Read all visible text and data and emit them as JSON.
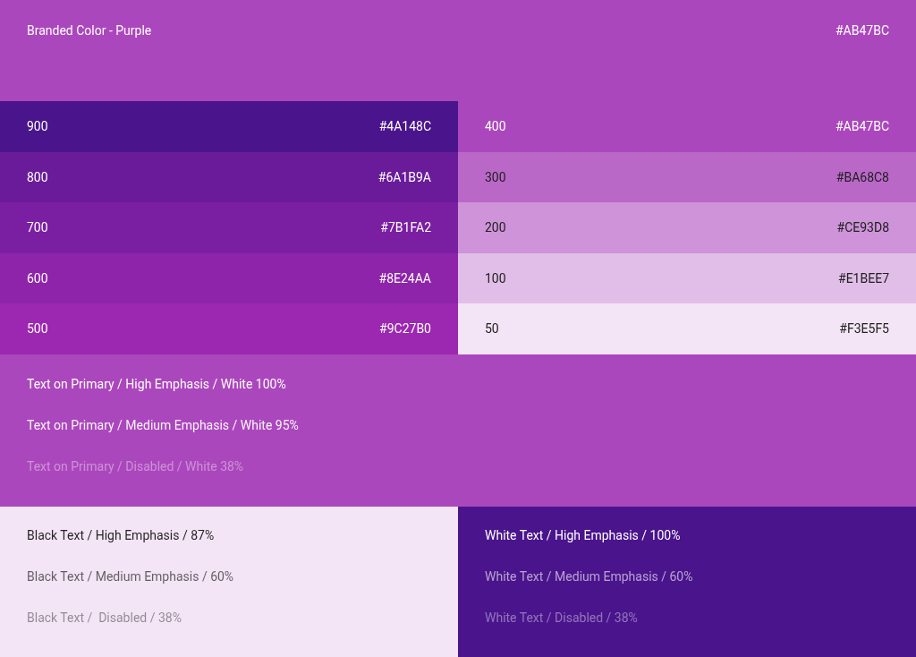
{
  "header": {
    "title": "Branded Color - Purple",
    "hex": "#AB47BC",
    "color": "#ab47bc"
  },
  "swatches_dark": [
    {
      "label": "900",
      "hex": "#4A148C",
      "color": "#4a148c"
    },
    {
      "label": "800",
      "hex": "#6A1B9A",
      "color": "#6a1b9a"
    },
    {
      "label": "700",
      "hex": "#7B1FA2",
      "color": "#7b1fa2"
    },
    {
      "label": "600",
      "hex": "#8E24AA",
      "color": "#8e24aa"
    },
    {
      "label": "500",
      "hex": "#9C27B0",
      "color": "#9c27b0"
    }
  ],
  "swatches_light": [
    {
      "label": "400",
      "hex": "#AB47BC",
      "color": "#ab47bc"
    },
    {
      "label": "300",
      "hex": "#BA68C8",
      "color": "#ba68c8"
    },
    {
      "label": "200",
      "hex": "#CE93D8",
      "color": "#ce93d8"
    },
    {
      "label": "100",
      "hex": "#E1BEE7",
      "color": "#e1bee7"
    },
    {
      "label": "50",
      "hex": "#F3E5F5",
      "color": "#f3e5f5"
    }
  ],
  "text_on_primary": [
    {
      "text": "Text on Primary / High Emphasis / White 100%",
      "kind": "high"
    },
    {
      "text": "Text on Primary / Medium Emphasis / White 95%",
      "kind": "medium"
    },
    {
      "text": "Text on Primary / Disabled / White 38%",
      "kind": "disabled"
    }
  ],
  "black_text": [
    {
      "text": "Black Text / High Emphasis / 87%",
      "kind": "high"
    },
    {
      "text": "Black Text / Medium Emphasis / 60%",
      "kind": "medium"
    },
    {
      "text": "Black Text /  Disabled / 38%",
      "kind": "disabled"
    }
  ],
  "white_text": [
    {
      "text": "White Text / High Emphasis / 100%",
      "kind": "high"
    },
    {
      "text": "White Text / Medium Emphasis / 60%",
      "kind": "medium"
    },
    {
      "text": "White Text / Disabled / 38%",
      "kind": "disabled"
    }
  ]
}
